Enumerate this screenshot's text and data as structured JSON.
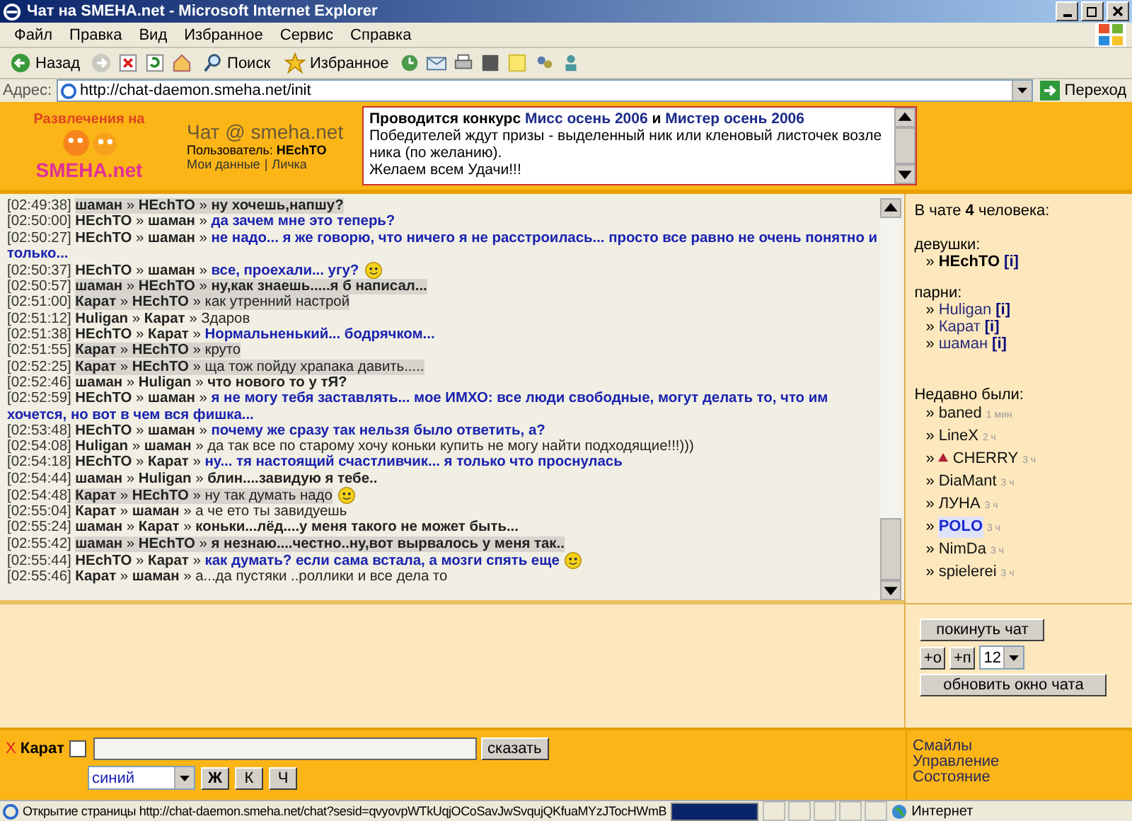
{
  "window": {
    "title": "Чат на SMEHA.net - Microsoft Internet Explorer"
  },
  "menu": [
    "Файл",
    "Правка",
    "Вид",
    "Избранное",
    "Сервис",
    "Справка"
  ],
  "toolbar": {
    "back": "Назад",
    "search": "Поиск",
    "favorites": "Избранное"
  },
  "address": {
    "label": "Адрес:",
    "url": "http://chat-daemon.smeha.net/init",
    "go": "Переход"
  },
  "header": {
    "logo_top": "Развлечения на",
    "logo_bottom": "SMEHA.net",
    "title": "Чат @ smeha.net",
    "user_label": "Пользователь:",
    "user": "HEchTO",
    "links": [
      "Мои данные",
      "Личка"
    ],
    "link_separator": "|"
  },
  "notice": {
    "headline": [
      {
        "text": "Проводится конкурс ",
        "link": false
      },
      {
        "text": "Мисс осень 2006",
        "link": true
      },
      {
        "text": " и ",
        "link": false
      },
      {
        "text": "Мистер осень 2006",
        "link": true
      }
    ],
    "lines": [
      "Победителей ждут призы - выделенный ник или кленовый листочек возле ника (по желанию).",
      "Желаем всем Удачи!!!"
    ]
  },
  "messages": [
    {
      "time": "[02:49:38]",
      "from": "**шаман** »",
      "to": "**HEchTO** »",
      "text": "ну хочешь,напшу?",
      "kind": "bold",
      "highlighted": true,
      "smiley": false
    },
    {
      "time": "[02:50:00]",
      "from": "**HEchTO** »",
      "to": "**шаман** »",
      "text": "да зачем мне это теперь?",
      "kind": "blue",
      "highlighted": false,
      "smiley": false
    },
    {
      "time": "[02:50:27]",
      "from": "**HEchTO** »",
      "to": "**шаман** »",
      "text": "не надо... я же говорю, что ничего я не расстроилась... просто все равно не очень понятно и только...",
      "kind": "blue",
      "highlighted": false,
      "smiley": false
    },
    {
      "time": "[02:50:37]",
      "from": "**HEchTO** »",
      "to": "**шаман** »",
      "text": "все, проехали... угу?",
      "kind": "blue",
      "highlighted": false,
      "smiley": true
    },
    {
      "time": "[02:50:57]",
      "from": "**шаман** »",
      "to": "**HEchTO** »",
      "text": "ну,как знаешь.....я б написал...",
      "kind": "bold",
      "highlighted": true,
      "smiley": false
    },
    {
      "time": "[02:51:00]",
      "from": "**Карат** »",
      "to": "**HEchTO** »",
      "text": "как утренний настрой",
      "kind": "plain",
      "highlighted": true,
      "smiley": false
    },
    {
      "time": "[02:51:12]",
      "from": "**Huligan** »",
      "to": "**Карат** »",
      "text": "Здаров",
      "kind": "plain",
      "highlighted": false,
      "smiley": false
    },
    {
      "time": "[02:51:38]",
      "from": "**HEchTO** »",
      "to": "**Карат** »",
      "text": "Нормальненький... бодрячком...",
      "kind": "blue",
      "highlighted": false,
      "smiley": false
    },
    {
      "time": "[02:51:55]",
      "from": "**Карат** »",
      "to": "**HEchTO** »",
      "text": "круто",
      "kind": "plain",
      "highlighted": true,
      "smiley": false
    },
    {
      "time": "[02:52:25]",
      "from": "**Карат** »",
      "to": "**HEchTO** »",
      "text": "ща тож пойду храпака давить.....",
      "kind": "plain",
      "highlighted": true,
      "smiley": false
    },
    {
      "time": "[02:52:46]",
      "from": "**шаман** »",
      "to": "**Huligan** »",
      "text": "что нового то у тЯ?",
      "kind": "bold",
      "highlighted": false,
      "smiley": false
    },
    {
      "time": "[02:52:59]",
      "from": "**HEchTO** »",
      "to": "**шаман** »",
      "text": "я не могу тебя заставлять... мое ИМХО: все люди свободные, могут делать то, что им хочется, но вот в чем вся фишка...",
      "kind": "blue",
      "highlighted": false,
      "smiley": false
    },
    {
      "time": "[02:53:48]",
      "from": "**HEchTO** »",
      "to": "**шаман** »",
      "text": "почему же сразу так нельзя было ответить, а?",
      "kind": "blue",
      "highlighted": false,
      "smiley": false
    },
    {
      "time": "[02:54:08]",
      "from": "**Huligan** »",
      "to": "**шаман** »",
      "text": "да так все по старому хочу коньки купить не могу найти подходящие!!!)))",
      "kind": "plain",
      "highlighted": false,
      "smiley": false
    },
    {
      "time": "[02:54:18]",
      "from": "**HEchTO** »",
      "to": "**Карат** »",
      "text": "ну... тя настоящий счастливчик... я только что проснулась",
      "kind": "blue",
      "highlighted": false,
      "smiley": false
    },
    {
      "time": "[02:54:44]",
      "from": "**шаман** »",
      "to": "**Huligan** »",
      "text": "блин....завидую я тебе..",
      "kind": "bold",
      "highlighted": false,
      "smiley": false
    },
    {
      "time": "[02:54:48]",
      "from": "**Карат** »",
      "to": "**HEchTO** »",
      "text": "ну так думать надо",
      "kind": "plain",
      "highlighted": true,
      "smiley": true
    },
    {
      "time": "[02:55:04]",
      "from": "**Карат** »",
      "to": "**шаман** »",
      "text": "а че ето ты завидуешь",
      "kind": "plain",
      "highlighted": false,
      "smiley": false
    },
    {
      "time": "[02:55:24]",
      "from": "**шаман** »",
      "to": "**Карат** »",
      "text": "коньки...лёд....у меня такого не может быть...",
      "kind": "bold",
      "highlighted": false,
      "smiley": false
    },
    {
      "time": "[02:55:42]",
      "from": "**шаман** »",
      "to": "**HEchTO** »",
      "text": "я незнаю....честно..ну,вот вырвалось у меня так..",
      "kind": "bold",
      "highlighted": true,
      "smiley": false
    },
    {
      "time": "[02:55:44]",
      "from": "**HEchTO** »",
      "to": "**Карат** »",
      "text": "как думать? если сама встала, а мозги спять еще",
      "kind": "blue",
      "highlighted": false,
      "smiley": true
    },
    {
      "time": "[02:55:46]",
      "from": "**Карат** »",
      "to": "**шаман** »",
      "text": "а...да пустяки ..роллики и все дела то",
      "kind": "plain",
      "highlighted": false,
      "smiley": false
    }
  ],
  "users": {
    "count": "В чате **4** человека:",
    "groups": [
      {
        "label": "девушки:",
        "members": [
          {
            "bullet": "»",
            "nick": "HEchTO",
            "info": "[i]",
            "self": true
          }
        ]
      },
      {
        "label": "парни:",
        "members": [
          {
            "bullet": "»",
            "nick": "Huligan",
            "info": "[i]",
            "self": false
          },
          {
            "bullet": "»",
            "nick": "Карат",
            "info": "[i]",
            "self": false
          },
          {
            "bullet": "»",
            "nick": "шаман",
            "info": "[i]",
            "self": false
          }
        ]
      }
    ],
    "recent_label": "Недавно были:",
    "recent": [
      {
        "bullet": "»",
        "nick": "baned",
        "ago": "1 мин",
        "kind": "plain"
      },
      {
        "bullet": "»",
        "nick": "LineX",
        "ago": "2 ч",
        "kind": "plain"
      },
      {
        "bullet": "»",
        "nick": "CHERRY",
        "ago": "3 ч",
        "kind": "badge"
      },
      {
        "bullet": "»",
        "nick": "DiaMant",
        "ago": "3 ч",
        "kind": "plain"
      },
      {
        "bullet": "»",
        "nick": "ЛУНА",
        "ago": "3 ч",
        "kind": "plain"
      },
      {
        "bullet": "»",
        "nick": "POLO",
        "ago": "3 ч",
        "kind": "outlined"
      },
      {
        "bullet": "»",
        "nick": "NimDa",
        "ago": "3 ч",
        "kind": "plain"
      },
      {
        "bullet": "»",
        "nick": "spielerei",
        "ago": "3 ч",
        "kind": "plain"
      }
    ]
  },
  "controls": {
    "leave": "покинуть чат",
    "plus_o": "+о",
    "plus_p": "+п",
    "size": "12",
    "refresh": "обновить окно чата"
  },
  "input": {
    "clear": "X",
    "nick": "Карат",
    "private": false,
    "say": "сказать",
    "ink": "синий",
    "bold": "Ж",
    "italic": "К",
    "underline": "Ч"
  },
  "side_links": [
    "Смайлы",
    "Управление",
    "Состояние"
  ],
  "status_bar": {
    "text": "Открытие страницы http://chat-daemon.smeha.net/chat?sesid=qvyovpWTkUqjOCoSavJwSvqujQKfuaMYzJTocHWmB",
    "level": 1,
    "zone": "Интернет"
  }
}
